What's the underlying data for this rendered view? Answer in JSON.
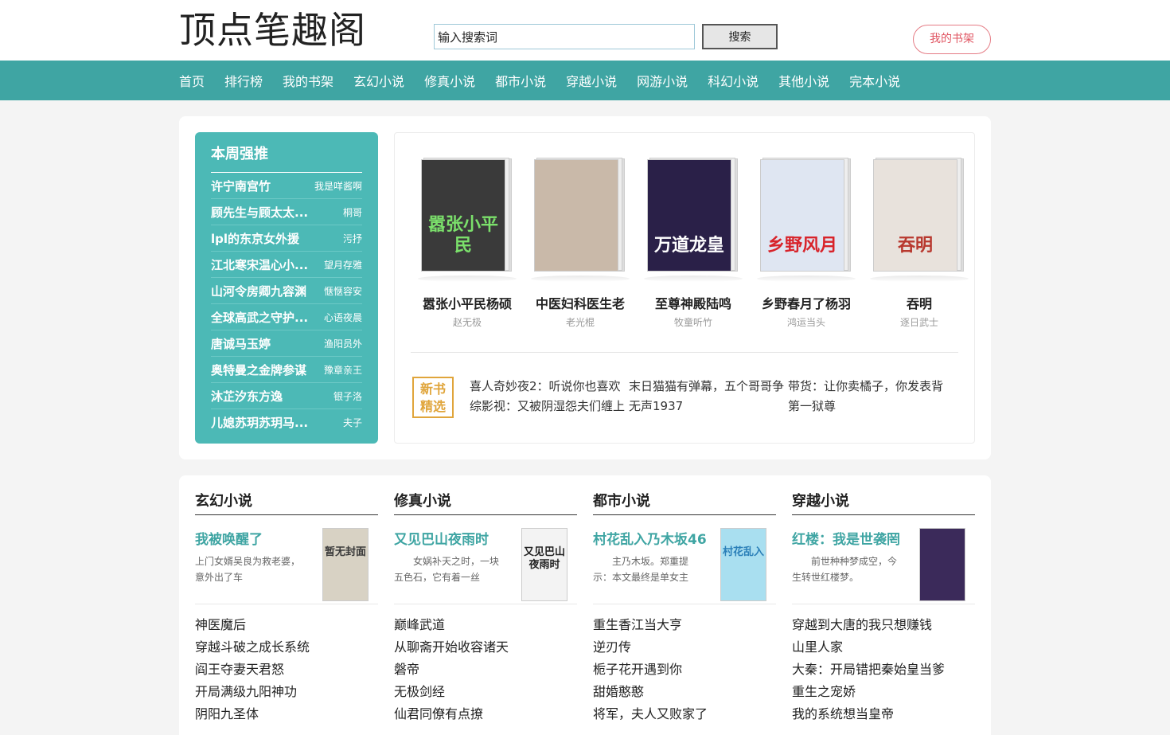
{
  "header": {
    "logo": "顶点笔趣阁",
    "search_value": "输入搜索词",
    "search_button": "搜索",
    "shelf_button": "我的书架"
  },
  "nav": [
    "首页",
    "排行榜",
    "我的书架",
    "玄幻小说",
    "修真小说",
    "都市小说",
    "穿越小说",
    "网游小说",
    "科幻小说",
    "其他小说",
    "完本小说"
  ],
  "weekly": {
    "title": "本周强推",
    "items": [
      {
        "title": "许宁南宫竹",
        "author": "我是咩酱啊"
      },
      {
        "title": "顾先生与顾太太...",
        "author": "桐哥"
      },
      {
        "title": "lpl的东京女外援",
        "author": "污抒"
      },
      {
        "title": "江北寒宋温心小...",
        "author": "望月存雅"
      },
      {
        "title": "山河令房卿九容渊",
        "author": "惬惬容安"
      },
      {
        "title": "全球高武之守护...",
        "author": "心语夜晨"
      },
      {
        "title": "唐诚马玉婷",
        "author": "渔阳员外"
      },
      {
        "title": "奥特曼之金牌参谋",
        "author": "豫章亲王"
      },
      {
        "title": "沐芷汐东方逸",
        "author": "银子洛"
      },
      {
        "title": "儿媳苏玥苏玥马...",
        "author": "夫子"
      }
    ]
  },
  "featured": {
    "books": [
      {
        "title": "嚣张小平民杨硕",
        "author": "赵无极",
        "cover_text": "嚣张小平民",
        "bg": "#3a3a3a",
        "fg": "#7be06b"
      },
      {
        "title": "中医妇科医生老",
        "author": "老光棍",
        "cover_text": "",
        "bg": "#c9b9a9",
        "fg": "#ffffff"
      },
      {
        "title": "至尊神殿陆鸣",
        "author": "牧童听竹",
        "cover_text": "万道龙皇",
        "bg": "#2a2048",
        "fg": "#ffffff"
      },
      {
        "title": "乡野春月了杨羽",
        "author": "鸿运当头",
        "cover_text": "乡野风月",
        "bg": "#dfe6f2",
        "fg": "#d8232a"
      },
      {
        "title": "吞明",
        "author": "逐日武士",
        "cover_text": "吞明",
        "bg": "#e8e2dc",
        "fg": "#b8392f"
      }
    ],
    "new_badge": "新书\n精选",
    "new_badge_line1": "新书",
    "new_badge_line2": "精选",
    "new_list": [
      "喜人奇妙夜2：听说你也喜欢",
      "末日猫猫有弹幕，五个哥哥争",
      "带货：让你卖橘子，你发表背",
      "综影视：又被阴湿怨夫们缠上",
      "无声1937",
      "第一狱尊"
    ]
  },
  "categories": [
    {
      "name": "玄幻小说",
      "top_title": "我被唤醒了",
      "top_desc": "上门女婿吴良为救老婆，意外出了车",
      "cover_text": "暂无封面",
      "cover_bg": "#d8d2c4",
      "cover_fg": "#3a3a3a",
      "list": [
        "神医魔后",
        "穿越斗破之成长系统",
        "阎王夺妻天君怒",
        "开局满级九阳神功",
        "阴阳九圣体"
      ]
    },
    {
      "name": "修真小说",
      "top_title": "又见巴山夜雨时",
      "top_desc": "　　女娲补天之时，一块五色石，它有着一丝",
      "cover_text": "又见巴山夜雨时",
      "cover_bg": "#f3f3f3",
      "cover_fg": "#222222",
      "list": [
        "巅峰武道",
        "从聊斋开始收容诸天",
        "磐帝",
        "无极剑经",
        "仙君同僚有点撩"
      ]
    },
    {
      "name": "都市小说",
      "top_title": "村花乱入乃木坂46",
      "top_desc": "　　主乃木坂。郑重提示：本文最终是单女主",
      "cover_text": "村花乱入",
      "cover_bg": "#a9dff0",
      "cover_fg": "#2a7fb8",
      "list": [
        "重生香江当大亨",
        "逆刃传",
        "栀子花开遇到你",
        "甜婚憨憨",
        "将军，夫人又败家了"
      ]
    },
    {
      "name": "穿越小说",
      "top_title": "红楼：我是世袭罔",
      "top_desc": "　　前世种种梦成空，今生转世红楼梦。",
      "cover_text": "",
      "cover_bg": "#3b2a5a",
      "cover_fg": "#e6c8ff",
      "list": [
        "穿越到大唐的我只想赚钱",
        "山里人家",
        "大秦：开局错把秦始皇当爹",
        "重生之宠娇",
        "我的系统想当皇帝"
      ]
    }
  ]
}
